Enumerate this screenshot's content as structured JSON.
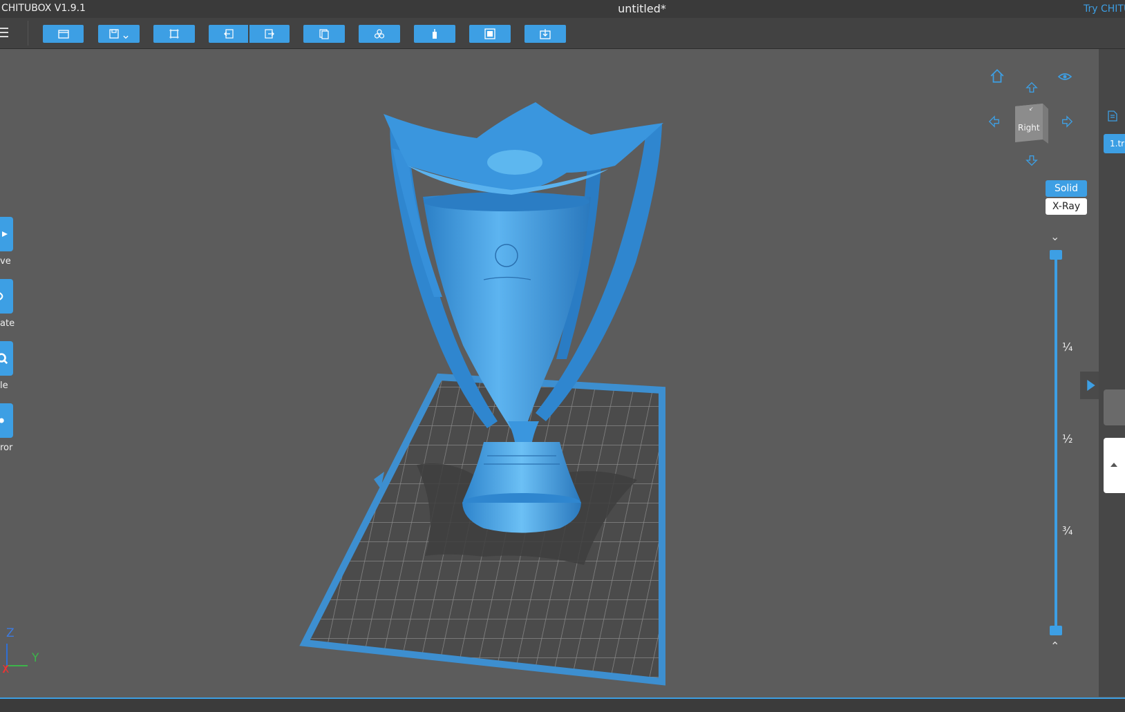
{
  "window": {
    "app_name": "CHITUBOX V1.9.1",
    "document_title": "untitled*",
    "try_link": "Try CHITU"
  },
  "toolbar": {
    "buttons": [
      {
        "name": "open-file",
        "icon": "folder-icon"
      },
      {
        "name": "save",
        "icon": "save-icon",
        "dropdown": true
      },
      {
        "name": "auto-layout",
        "icon": "frame-icon"
      },
      {
        "name": "undo",
        "icon": "undo-icon"
      },
      {
        "name": "redo",
        "icon": "redo-icon"
      },
      {
        "name": "copy",
        "icon": "copy-icon"
      },
      {
        "name": "arrange",
        "icon": "cubes-icon"
      },
      {
        "name": "supports",
        "icon": "support-icon"
      },
      {
        "name": "hollow",
        "icon": "hollow-icon"
      },
      {
        "name": "slice",
        "icon": "slice-icon"
      }
    ]
  },
  "left_tools": [
    {
      "label": "ve",
      "icon": "play-icon"
    },
    {
      "label": "ate",
      "icon": "rotate-icon"
    },
    {
      "label": "le",
      "icon": "scale-icon"
    },
    {
      "label": "ror",
      "icon": "mirror-icon"
    }
  ],
  "view": {
    "navcube_face": "Right",
    "solid_label": "Solid",
    "xray_label": "X-Ray",
    "active_mode": "Solid"
  },
  "layer_slider": {
    "ticks": [
      "¼",
      "½",
      "¾"
    ],
    "top_value": 1.0,
    "bottom_value": 0.0
  },
  "right_panel": {
    "file_item": "1.tr"
  },
  "axes": {
    "z_label": "Z",
    "y_label": "Y",
    "x_label": "X"
  },
  "colors": {
    "accent": "#3d9fe4",
    "background": "#5c5c5c",
    "model": "#3a94de"
  }
}
